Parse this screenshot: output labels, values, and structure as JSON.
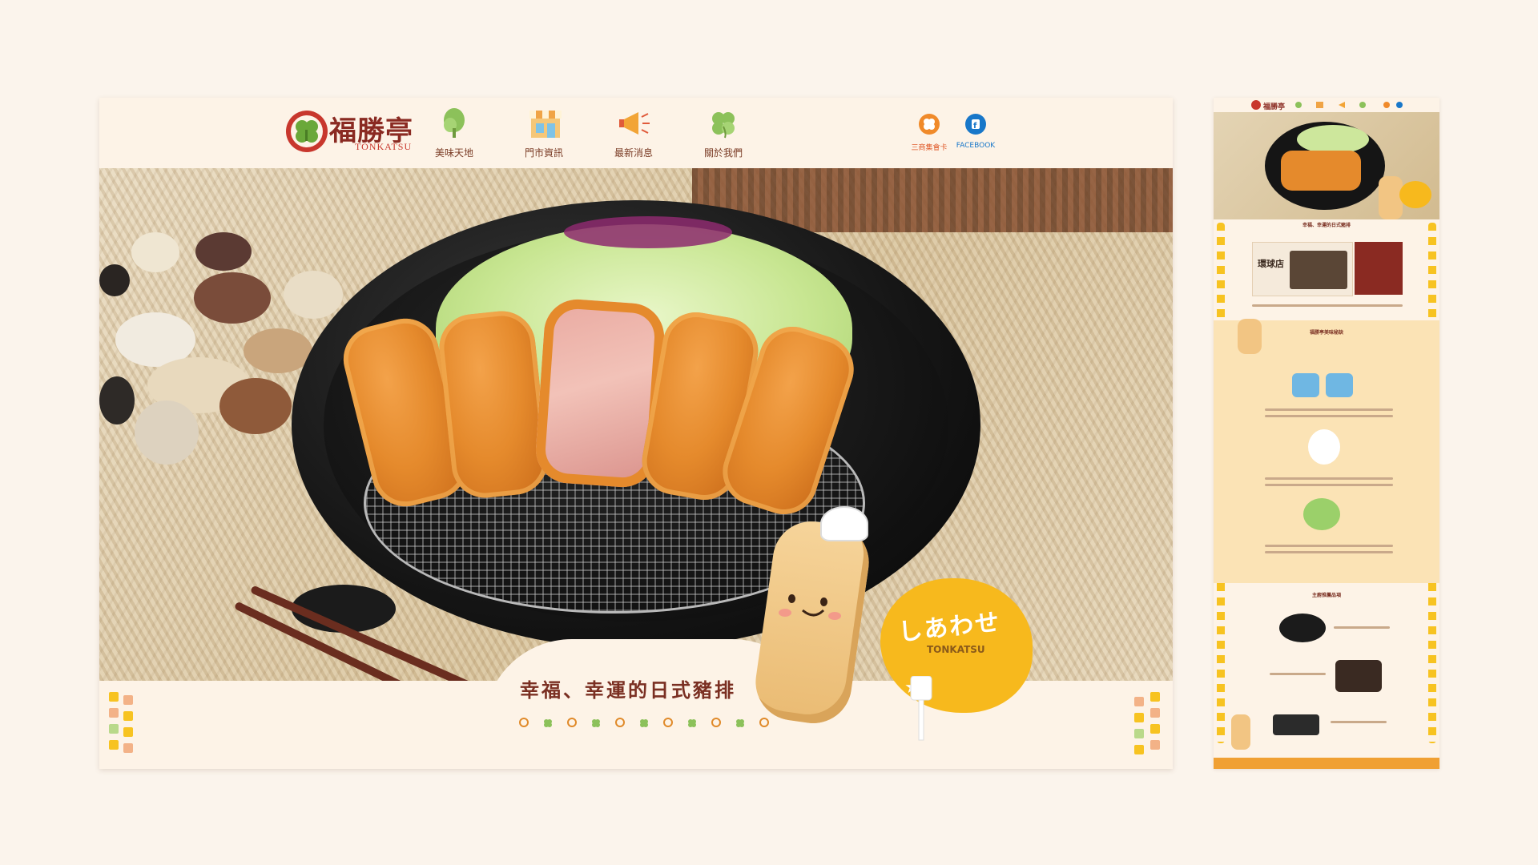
{
  "site": {
    "brand": "福勝亭",
    "brand_sub": "TONKATSU",
    "colors": {
      "brand_red": "#c8372d",
      "accent_orange": "#e08a2a",
      "cream": "#fdf3e7",
      "facebook_blue": "#1877c9",
      "mascot_yellow": "#f7b91d"
    }
  },
  "nav": {
    "items": [
      {
        "label": "美味天地",
        "icon": "tree-icon"
      },
      {
        "label": "門市資訊",
        "icon": "storefront-icon"
      },
      {
        "label": "最新消息",
        "icon": "megaphone-icon"
      },
      {
        "label": "關於我們",
        "icon": "clover-icon"
      }
    ],
    "social": [
      {
        "label": "三商集會卡",
        "icon": "clover-badge-icon"
      },
      {
        "label": "FACEBOOK",
        "icon": "facebook-icon"
      }
    ]
  },
  "hero": {
    "tagline": "幸福、幸運的日式豬排",
    "bubble_kana": "しあわせ",
    "bubble_en": "TONKATSU"
  },
  "preview": {
    "logo": "福勝亭",
    "section_title": "幸福、幸運的日式豬排",
    "store_sign": "環球店",
    "band_title": "福勝亭美味秘訣",
    "menu_title": "主廚推薦品項"
  }
}
